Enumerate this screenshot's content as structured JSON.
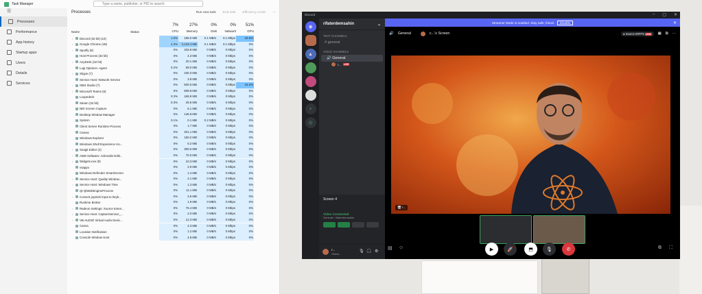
{
  "taskmanager": {
    "title": "Task Manager",
    "search_placeholder": "Type a name, publisher, or PID to search",
    "nav": [
      "Processes",
      "Performance",
      "App history",
      "Startup apps",
      "Users",
      "Details",
      "Services"
    ],
    "heading": "Processes",
    "actions": {
      "run": "Run new task",
      "end": "End task",
      "eff": "Efficiency mode"
    },
    "totals": {
      "cpu": "7%",
      "mem": "27%",
      "disk": "0%",
      "net": "0%",
      "gpu": "51%"
    },
    "cols": {
      "name": "Name",
      "status": "Status",
      "cpu": "CPU",
      "mem": "Memory",
      "disk": "Disk",
      "net": "Network",
      "gpu": "GPU"
    },
    "rows": [
      [
        "Discord (32 bit) (10)",
        "1.0%",
        "155.0 MB",
        "0.1 MB/s",
        "0.1 Mbps",
        "32.8%"
      ],
      [
        "Google Chrome (48)",
        "4.3%",
        "3,133.4 MB",
        "0.1 MB/s",
        "0.1 Mbps",
        "0%"
      ],
      [
        "Spotify (9)",
        "0%",
        "333.8 MB",
        "0 MB/s",
        "0 Mbps",
        "0%"
      ],
      [
        "Host Process (32 bit)",
        "0%",
        "4.3 MB",
        "0 MB/s",
        "0 Mbps",
        "0%"
      ],
      [
        "AnyDesk (32 bit)",
        "0%",
        "20.1 MB",
        "0 MB/s",
        "0 Mbps",
        "0%"
      ],
      [
        "Logi Options+ Agent",
        "0.2%",
        "59.0 MB",
        "0 MB/s",
        "0 Mbps",
        "0%"
      ],
      [
        "Skype (7)",
        "0%",
        "230.3 MB",
        "0 MB/s",
        "0 Mbps",
        "0%"
      ],
      [
        "Service Host: Network Service",
        "0%",
        "3.8 MB",
        "0 MB/s",
        "0 Mbps",
        "0%"
      ],
      [
        "OBS Studio (7)",
        "0%",
        "500.6 MB",
        "0 MB/s",
        "0 Mbps",
        "34.6%"
      ],
      [
        "Microsoft Teams (8)",
        "0%",
        "809.8 MB",
        "0 MB/s",
        "0 Mbps",
        "0%"
      ],
      [
        "Loupedeck",
        "0.3%",
        "165.9 MB",
        "0 MB/s",
        "0 Mbps",
        "0%"
      ],
      [
        "Steam (32 bit)",
        "0.3%",
        "29.6 MB",
        "0 MB/s",
        "0 Mbps",
        "0%"
      ],
      [
        "NDI Screen Capture",
        "0%",
        "6.1 MB",
        "0 MB/s",
        "0 Mbps",
        "0%"
      ],
      [
        "Desktop Window Manager",
        "0%",
        "146.8 MB",
        "0 MB/s",
        "0 Mbps",
        "0%"
      ],
      [
        "System",
        "0.1%",
        "0.1 MB",
        "0.2 MB/s",
        "0 Mbps",
        "0%"
      ],
      [
        "Client Server Runtime Process",
        "0%",
        "1.7 MB",
        "0 MB/s",
        "0 Mbps",
        "0%"
      ],
      [
        "Camac",
        "0%",
        "201.1 MB",
        "0 MB/s",
        "0 Mbps",
        "0%"
      ],
      [
        "Windows Explorer",
        "0%",
        "150.2 MB",
        "0 MB/s",
        "0 Mbps",
        "0%"
      ],
      [
        "Windows Shell Experience Ho...",
        "0%",
        "5.2 MB",
        "0 MB/s",
        "0 Mbps",
        "0%"
      ],
      [
        "Snagit Editor (2)",
        "0%",
        "300.6 MB",
        "0 MB/s",
        "0 Mbps",
        "0%"
      ],
      [
        "AMD Software: Adrenalin Editi...",
        "0%",
        "70.0 MB",
        "0 MB/s",
        "0 Mbps",
        "0%"
      ],
      [
        "Widgets.exe (9)",
        "0%",
        "10.3 MB",
        "0 MB/s",
        "0 Mbps",
        "0%"
      ],
      [
        "vsappx",
        "0%",
        "2.9 MB",
        "0 MB/s",
        "0 Mbps",
        "0%"
      ],
      [
        "Windows Defender SmartScreen",
        "0%",
        "1.4 MB",
        "0 MB/s",
        "0 Mbps",
        "0%"
      ],
      [
        "Service Host: Quality Window...",
        "0%",
        "2.1 MB",
        "0 MB/s",
        "0 Mbps",
        "0%"
      ],
      [
        "Service Host: Windows Time",
        "0%",
        "1.3 MB",
        "0 MB/s",
        "0 Mbps",
        "0%"
      ],
      [
        "Qt QtWebEngineProcess",
        "0%",
        "11.1 MB",
        "0 MB/s",
        "0 Mbps",
        "0%"
      ],
      [
        "Convert joystick input to keyb...",
        "0%",
        "3.6 MB",
        "0 MB/s",
        "0 Mbps",
        "0%"
      ],
      [
        "Runtime Broker",
        "0%",
        "1.9 MB",
        "0 MB/s",
        "0 Mbps",
        "0%"
      ],
      [
        "Radeon Settings: Source Exten...",
        "0%",
        "76.4 MB",
        "0 MB/s",
        "0 Mbps",
        "0%"
      ],
      [
        "Service Host: CaptureService_...",
        "0%",
        "2.0 MB",
        "0 MB/s",
        "0 Mbps",
        "0%"
      ],
      [
        "VB-AUDIO Virtual Audio Devic...",
        "0%",
        "12.3 MB",
        "0 MB/s",
        "0 Mbps",
        "0%"
      ],
      [
        "Canva",
        "0%",
        "4.3 MB",
        "0 MB/s",
        "0 Mbps",
        "0%"
      ],
      [
        "Location Notification",
        "0%",
        "1.2 MB",
        "0 MB/s",
        "0 Mbps",
        "0%"
      ],
      [
        "Console Window Host",
        "0%",
        "4.8 MB",
        "0 MB/s",
        "0 Mbps",
        "0%"
      ]
    ]
  },
  "discord": {
    "titlebar": "Discord",
    "banner": "Streamer Mode is enabled. Stay safe, friend.",
    "banner_btn": "Disable",
    "server": "rifaterdemsahin",
    "voice_channel": "General",
    "screen_title": "c...'s Screen",
    "source": "Source 60FPS",
    "live": "LIVE",
    "text_cat": "TEXT CHANNELS",
    "text_channel": "general",
    "voice_cat": "VOICE CHANNELS",
    "voice_general": "General",
    "voice_user": "r...",
    "screen_label": "Screen 4",
    "vc_status": "Video Connected",
    "vc_sub": "General / rifaterdemsahin",
    "user_name": "r...",
    "user_status": "Online",
    "stream_tag": "r..."
  }
}
